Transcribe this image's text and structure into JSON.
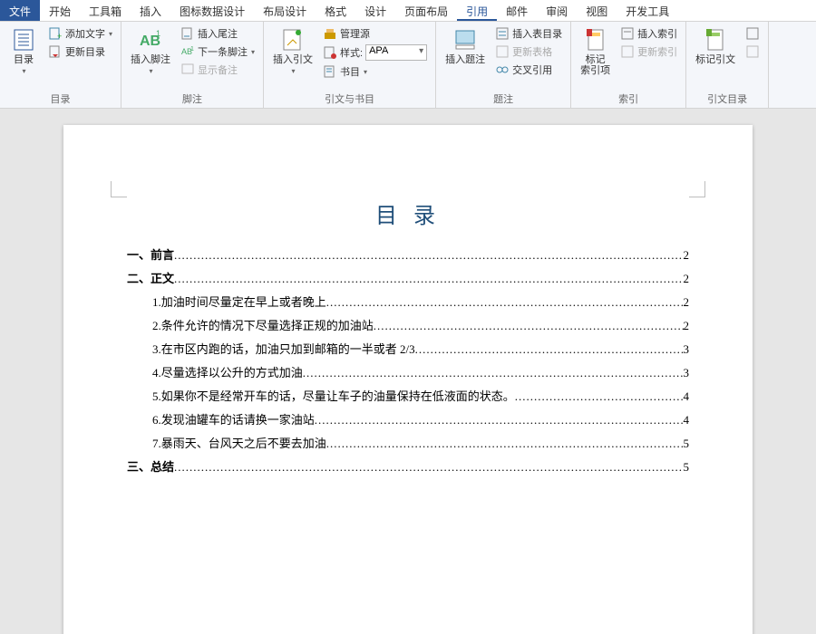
{
  "menu": {
    "file": "文件",
    "tabs": [
      "开始",
      "工具箱",
      "插入",
      "图标数据设计",
      "布局设计",
      "格式",
      "设计",
      "页面布局",
      "引用",
      "邮件",
      "审阅",
      "视图",
      "开发工具"
    ],
    "active": "引用"
  },
  "ribbon": {
    "groups": {
      "toc": {
        "label": "目录",
        "toc_btn": "目录",
        "add_text": "添加文字",
        "update_toc": "更新目录"
      },
      "footnotes": {
        "label": "脚注",
        "insert_footnote": "插入脚注",
        "insert_endnote": "插入尾注",
        "next_footnote": "下一条脚注",
        "show_notes": "显示备注"
      },
      "citations": {
        "label": "引文与书目",
        "insert_citation": "插入引文",
        "manage_sources": "管理源",
        "style_label": "样式:",
        "style_value": "APA",
        "bibliography": "书目"
      },
      "captions": {
        "label": "题注",
        "insert_caption": "插入题注",
        "insert_tof": "插入表目录",
        "update_tables": "更新表格",
        "cross_ref": "交叉引用"
      },
      "index": {
        "label": "索引",
        "mark_entry": "标记\n索引项",
        "insert_index": "插入索引",
        "update_index": "更新索引"
      },
      "toa": {
        "label": "引文目录",
        "mark_citation": "标记引文"
      }
    }
  },
  "document": {
    "toc_title": "目 录",
    "entries": [
      {
        "text": "一、前言",
        "page": "2",
        "level": 1
      },
      {
        "text": "二、正文",
        "page": "2",
        "level": 1
      },
      {
        "text": "1.加油时间尽量定在早上或者晚上",
        "page": "2",
        "level": 2
      },
      {
        "text": "2.条件允许的情况下尽量选择正规的加油站",
        "page": "2",
        "level": 2
      },
      {
        "text": "3.在市区内跑的话，加油只加到邮箱的一半或者 2/3",
        "page": "3",
        "level": 2
      },
      {
        "text": "4.尽量选择以公升的方式加油",
        "page": "3",
        "level": 2
      },
      {
        "text": "5.如果你不是经常开车的话，尽量让车子的油量保持在低液面的状态。",
        "page": "4",
        "level": 2
      },
      {
        "text": "6.发现油罐车的话请换一家油站",
        "page": "4",
        "level": 2
      },
      {
        "text": "7.暴雨天、台风天之后不要去加油",
        "page": "5",
        "level": 2
      },
      {
        "text": "三、总结",
        "page": "5",
        "level": 1
      }
    ]
  },
  "colors": {
    "accent": "#2b579a",
    "title": "#1f4e79"
  }
}
